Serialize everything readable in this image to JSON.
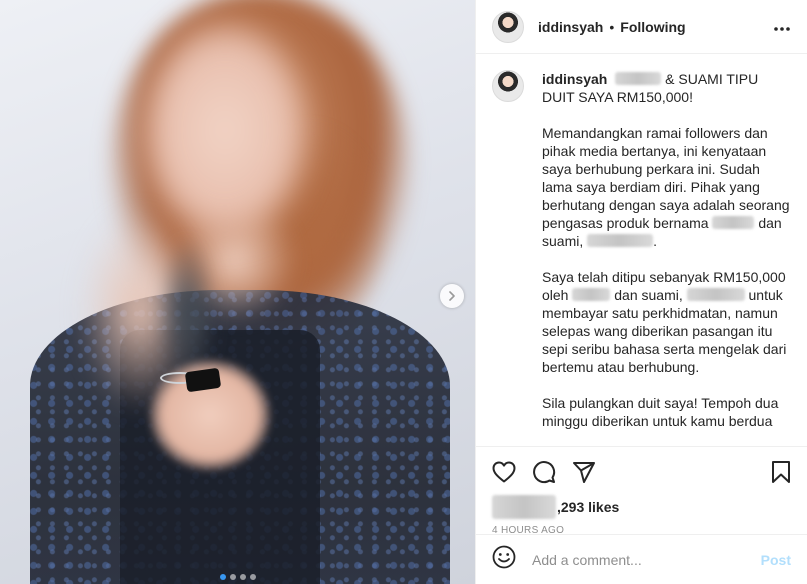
{
  "header": {
    "username": "iddinsyah",
    "separator": "•",
    "follow_status": "Following",
    "more_icon": "more-horizontal-icon"
  },
  "caption": {
    "username": "iddinsyah",
    "title_after_redaction": "& SUAMI TIPU DUIT SAYA RM150,000!",
    "para1": "Memandangkan ramai followers dan pihak media bertanya, ini kenyataan saya berhubung perkara ini. Sudah lama saya berdiam diri. Pihak yang berhutang dengan saya adalah seorang pengasas produk bernama",
    "para1_mid": "dan suami,",
    "para1_end": ".",
    "para2_start": "Saya telah ditipu sebanyak RM150,000 oleh",
    "para2_mid": "dan suami,",
    "para2_end": "untuk membayar satu perkhidmatan, namun selepas wang diberikan pasangan itu sepi seribu bahasa serta mengelak dari bertemu atau berhubung.",
    "para3": "Sila pulangkan duit saya! Tempoh dua minggu diberikan untuk kamu berdua"
  },
  "actions": {
    "like_icon": "heart-icon",
    "comment_icon": "comment-icon",
    "share_icon": "share-icon",
    "save_icon": "bookmark-icon"
  },
  "likes": {
    "count_suffix": ",293 likes"
  },
  "timestamp": "4 HOURS AGO",
  "comment": {
    "placeholder": "Add a comment...",
    "post_label": "Post",
    "emoji_icon": "emoji-icon"
  },
  "carousel": {
    "next_icon": "chevron-right-icon",
    "slide_count": 4,
    "active_index": 0
  },
  "colors": {
    "text": "#262626",
    "muted": "#8e8e8e",
    "border": "#efefef",
    "post_disabled": "#b2dffc",
    "dot_active": "#3897f0"
  }
}
